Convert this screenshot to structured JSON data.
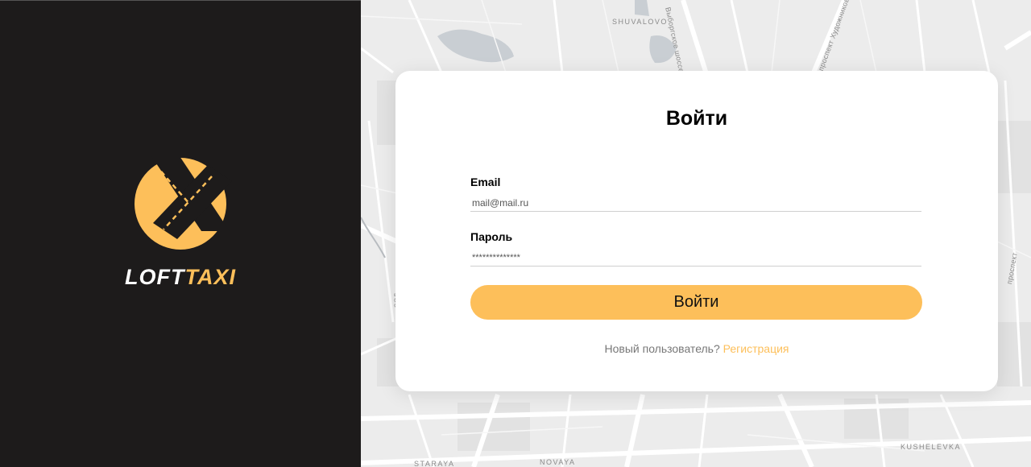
{
  "brand": {
    "logo_icon": "road-taxi-logo",
    "name_part1": "LOFT",
    "name_part2": "TAXI",
    "accent_color": "#fdbf5a"
  },
  "map": {
    "labels": {
      "shuvalovo": "SHUVALOVO",
      "vyborgskoe": "Выборгское шоссе",
      "prospekt": "проспект Художников",
      "kushelevka": "KUSHELEVKA",
      "staraya": "STARAYA",
      "novaya": "NOVAYA",
      "edge_left": "ЗСД",
      "edge_right": "проспект"
    }
  },
  "login": {
    "title": "Войти",
    "email_label": "Email",
    "email_value": "mail@mail.ru",
    "password_label": "Пароль",
    "password_value": "**************",
    "submit_label": "Войти",
    "new_user_text": "Новый пользователь?",
    "register_link": "Регистрация"
  }
}
